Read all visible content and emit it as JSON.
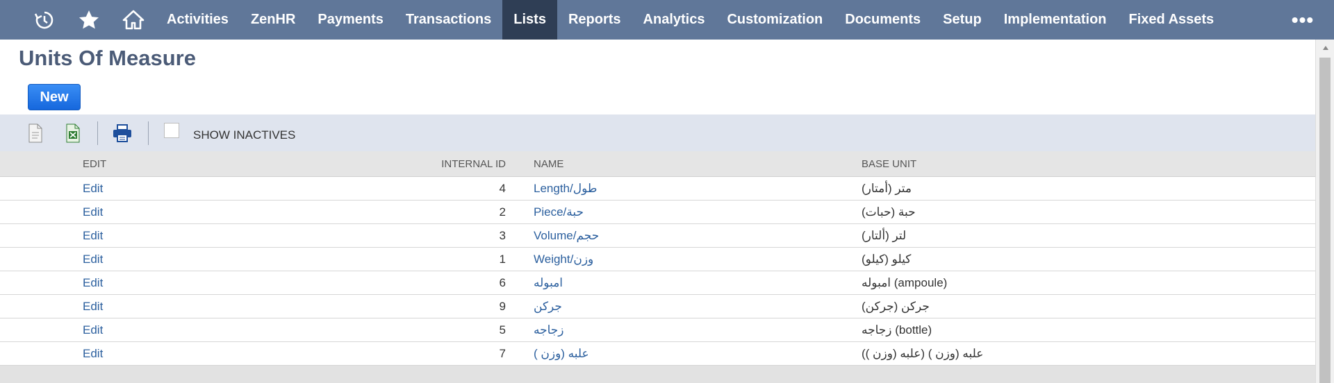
{
  "nav": {
    "icons": [
      "recent-history-icon",
      "star-icon",
      "home-icon"
    ],
    "items": [
      {
        "label": "Activities",
        "active": false
      },
      {
        "label": "ZenHR",
        "active": false
      },
      {
        "label": "Payments",
        "active": false
      },
      {
        "label": "Transactions",
        "active": false
      },
      {
        "label": "Lists",
        "active": true
      },
      {
        "label": "Reports",
        "active": false
      },
      {
        "label": "Analytics",
        "active": false
      },
      {
        "label": "Customization",
        "active": false
      },
      {
        "label": "Documents",
        "active": false
      },
      {
        "label": "Setup",
        "active": false
      },
      {
        "label": "Implementation",
        "active": false
      },
      {
        "label": "Fixed Assets",
        "active": false
      }
    ],
    "more": "•••"
  },
  "page": {
    "title": "Units Of Measure",
    "new_label": "New"
  },
  "toolbar": {
    "show_inactives_label": "SHOW INACTIVES",
    "show_inactives_checked": false
  },
  "table": {
    "headers": {
      "edit": "EDIT",
      "internal_id": "INTERNAL ID",
      "name": "NAME",
      "base_unit": "BASE UNIT"
    },
    "rows": [
      {
        "edit": "Edit",
        "id": "4",
        "name": "Length/طول",
        "base": "متر (أمتار)"
      },
      {
        "edit": "Edit",
        "id": "2",
        "name": "Piece/حبة",
        "base": "حبة (حبات)"
      },
      {
        "edit": "Edit",
        "id": "3",
        "name": "Volume/حجم",
        "base": "لتر (ألتار)"
      },
      {
        "edit": "Edit",
        "id": "1",
        "name": "Weight/وزن",
        "base": "كيلو (كيلو)"
      },
      {
        "edit": "Edit",
        "id": "6",
        "name": "امبوله",
        "base": "امبوله (ampoule)"
      },
      {
        "edit": "Edit",
        "id": "9",
        "name": "جركن",
        "base": "جركن (جركن)"
      },
      {
        "edit": "Edit",
        "id": "5",
        "name": "زجاجه",
        "base": "زجاجه (bottle)"
      },
      {
        "edit": "Edit",
        "id": "7",
        "name": "علبه (وزن )",
        "base": "علبه (وزن ) (علبه (وزن ))"
      }
    ]
  },
  "colors": {
    "nav_bg": "#607799",
    "nav_active": "#2f3e55",
    "title": "#4b5b77",
    "button": "#1a73e8",
    "link": "#2b5f9e",
    "toolbar_bg": "#dfe4ee"
  }
}
